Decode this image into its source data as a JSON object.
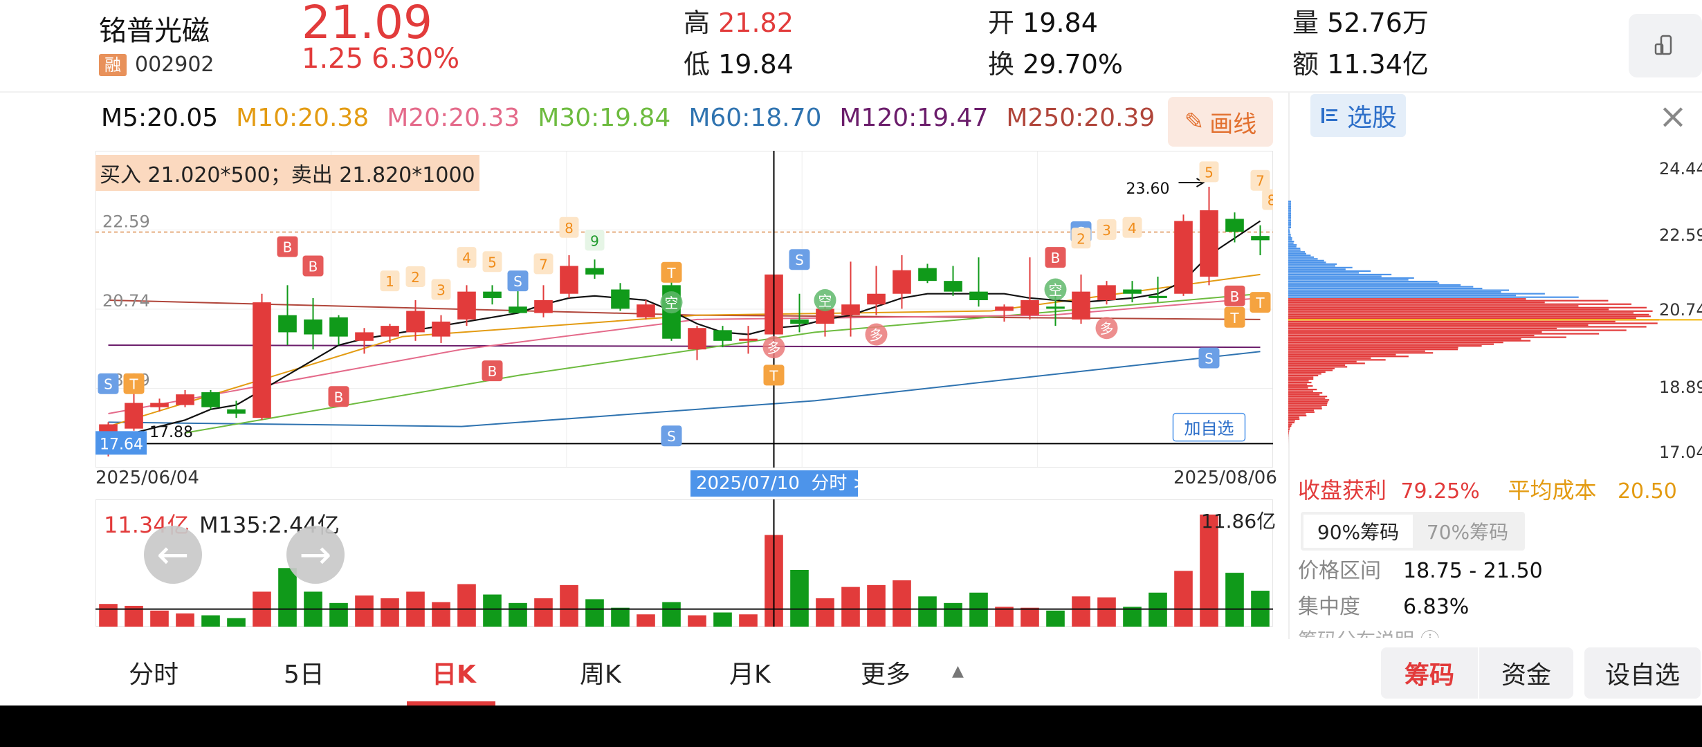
{
  "header": {
    "name": "铭普光磁",
    "badge": "融",
    "code": "002902",
    "price": "21.09",
    "change": "1.25",
    "change_pct": "6.30%",
    "stats": [
      {
        "label": "高",
        "value": "21.82",
        "color": "#e23b3b"
      },
      {
        "label": "低",
        "value": "19.84",
        "color": "#111111"
      },
      {
        "label": "开",
        "value": "19.84",
        "color": "#111111"
      },
      {
        "label": "换",
        "value": "29.70%",
        "color": "#111111"
      },
      {
        "label": "量",
        "value": "52.76万",
        "color": "#111111"
      },
      {
        "label": "额",
        "value": "11.34亿",
        "color": "#111111"
      }
    ]
  },
  "ma_bar": [
    {
      "text": "M5:20.05",
      "color": "#111111"
    },
    {
      "text": "M10:20.38",
      "color": "#e39b12"
    },
    {
      "text": "M20:20.33",
      "color": "#e46a8a"
    },
    {
      "text": "M30:19.84",
      "color": "#6dbb3f"
    },
    {
      "text": "M60:18.70",
      "color": "#2f73b0"
    },
    {
      "text": "M120:19.47",
      "color": "#6b1d6b"
    },
    {
      "text": "M250:20.39",
      "color": "#b0453a"
    }
  ],
  "draw_button": "画线",
  "trade_note": "买入 21.020*500；卖出 21.820*1000",
  "chart": {
    "y_labels": [
      "22.59",
      "20.74",
      "18.89"
    ],
    "high_marker": "23.60",
    "low_marker": "17.88",
    "low_badge": "17.64",
    "date_start": "2025/06/04",
    "date_end": "2025/08/06",
    "cursor_date": "2025/07/10",
    "cursor_link": "分时 >",
    "add_watch": "加自选"
  },
  "chart_data": {
    "type": "candlestick",
    "ylim": [
      17.04,
      24.44
    ],
    "candles": [
      {
        "o": 17.4,
        "h": 18.1,
        "l": 17.3,
        "c": 18.05
      },
      {
        "o": 17.95,
        "h": 18.8,
        "l": 17.9,
        "c": 18.55
      },
      {
        "o": 18.45,
        "h": 18.65,
        "l": 18.35,
        "c": 18.55
      },
      {
        "o": 18.5,
        "h": 18.85,
        "l": 18.45,
        "c": 18.75
      },
      {
        "o": 18.8,
        "h": 18.85,
        "l": 18.4,
        "c": 18.45
      },
      {
        "o": 18.4,
        "h": 18.6,
        "l": 18.2,
        "c": 18.3
      },
      {
        "o": 18.2,
        "h": 21.1,
        "l": 18.15,
        "c": 20.9
      },
      {
        "o": 20.6,
        "h": 21.3,
        "l": 19.9,
        "c": 20.2
      },
      {
        "o": 20.5,
        "h": 21.0,
        "l": 19.8,
        "c": 20.15
      },
      {
        "o": 20.55,
        "h": 20.6,
        "l": 19.9,
        "c": 20.1
      },
      {
        "o": 20.0,
        "h": 20.3,
        "l": 19.7,
        "c": 20.2
      },
      {
        "o": 20.1,
        "h": 20.4,
        "l": 19.95,
        "c": 20.35
      },
      {
        "o": 20.2,
        "h": 20.95,
        "l": 20.0,
        "c": 20.7
      },
      {
        "o": 20.1,
        "h": 20.6,
        "l": 19.95,
        "c": 20.45
      },
      {
        "o": 20.5,
        "h": 21.3,
        "l": 20.35,
        "c": 21.15
      },
      {
        "o": 21.15,
        "h": 21.3,
        "l": 20.85,
        "c": 21.0
      },
      {
        "o": 20.8,
        "h": 21.2,
        "l": 20.7,
        "c": 20.65
      },
      {
        "o": 20.65,
        "h": 21.3,
        "l": 20.55,
        "c": 20.95
      },
      {
        "o": 21.1,
        "h": 22.0,
        "l": 21.0,
        "c": 21.75
      },
      {
        "o": 21.7,
        "h": 21.9,
        "l": 21.45,
        "c": 21.55
      },
      {
        "o": 21.2,
        "h": 21.35,
        "l": 20.7,
        "c": 20.75
      },
      {
        "o": 20.55,
        "h": 20.95,
        "l": 20.5,
        "c": 20.85
      },
      {
        "o": 21.3,
        "h": 21.45,
        "l": 20.0,
        "c": 20.05
      },
      {
        "o": 19.8,
        "h": 20.35,
        "l": 19.55,
        "c": 20.3
      },
      {
        "o": 20.25,
        "h": 20.35,
        "l": 19.85,
        "c": 20.0
      },
      {
        "o": 20.0,
        "h": 20.35,
        "l": 19.7,
        "c": 20.05
      },
      {
        "o": 20.15,
        "h": 21.8,
        "l": 19.5,
        "c": 21.55
      },
      {
        "o": 20.5,
        "h": 21.1,
        "l": 20.2,
        "c": 20.4
      },
      {
        "o": 20.4,
        "h": 20.95,
        "l": 20.1,
        "c": 20.75
      },
      {
        "o": 20.6,
        "h": 21.85,
        "l": 20.1,
        "c": 20.85
      },
      {
        "o": 20.85,
        "h": 21.75,
        "l": 20.6,
        "c": 21.1
      },
      {
        "o": 21.1,
        "h": 22.0,
        "l": 20.75,
        "c": 21.65
      },
      {
        "o": 21.7,
        "h": 21.8,
        "l": 21.35,
        "c": 21.4
      },
      {
        "o": 21.4,
        "h": 21.75,
        "l": 21.05,
        "c": 21.15
      },
      {
        "o": 21.15,
        "h": 21.95,
        "l": 20.8,
        "c": 20.95
      },
      {
        "o": 20.7,
        "h": 20.85,
        "l": 20.45,
        "c": 20.8
      },
      {
        "o": 20.6,
        "h": 21.95,
        "l": 20.5,
        "c": 20.95
      },
      {
        "o": 20.8,
        "h": 21.05,
        "l": 20.35,
        "c": 20.75
      },
      {
        "o": 20.5,
        "h": 21.55,
        "l": 20.4,
        "c": 21.15
      },
      {
        "o": 20.95,
        "h": 21.4,
        "l": 20.85,
        "c": 21.3
      },
      {
        "o": 21.2,
        "h": 21.4,
        "l": 20.9,
        "c": 21.1
      },
      {
        "o": 21.05,
        "h": 21.5,
        "l": 20.9,
        "c": 21.0
      },
      {
        "o": 21.1,
        "h": 22.95,
        "l": 21.05,
        "c": 22.8
      },
      {
        "o": 21.5,
        "h": 23.6,
        "l": 21.3,
        "c": 23.05
      },
      {
        "o": 22.85,
        "h": 23.0,
        "l": 22.3,
        "c": 22.55
      },
      {
        "o": 22.45,
        "h": 22.7,
        "l": 22.0,
        "c": 22.35
      }
    ],
    "ma5": [
      17.8,
      17.85,
      18.0,
      18.15,
      18.4,
      18.5,
      18.85,
      19.2,
      19.55,
      19.9,
      20.05,
      20.15,
      20.25,
      20.35,
      20.45,
      20.55,
      20.65,
      20.85,
      21.0,
      21.05,
      21.0,
      20.95,
      20.7,
      20.4,
      20.2,
      20.15,
      20.3,
      20.35,
      20.5,
      20.6,
      20.8,
      21.0,
      21.1,
      21.1,
      21.1,
      21.1,
      21.0,
      20.95,
      20.9,
      20.95,
      21.0,
      21.1,
      21.4,
      22.0,
      22.4,
      22.8
    ],
    "volume": {
      "values": [
        2.4,
        2.2,
        1.7,
        1.4,
        1.2,
        0.9,
        3.7,
        6.2,
        3.7,
        2.5,
        3.3,
        3.0,
        3.7,
        2.6,
        4.5,
        3.4,
        2.5,
        3.0,
        4.4,
        2.9,
        2.0,
        1.3,
        2.6,
        1.2,
        1.5,
        1.3,
        9.7,
        6.0,
        3.0,
        4.2,
        4.4,
        4.9,
        3.2,
        2.5,
        3.6,
        2.1,
        2.0,
        1.7,
        3.2,
        3.1,
        2.1,
        3.6,
        5.9,
        11.86,
        5.7,
        3.8
      ],
      "ma": 2.44,
      "ylim": [
        0,
        12
      ]
    },
    "distribution_ylim": [
      17.04,
      24.44
    ]
  },
  "volume_panel": {
    "total": "11.34亿",
    "ma_label": "M135:2.44亿",
    "max_label": "11.86亿"
  },
  "right_panel": {
    "select_button": "选股",
    "y_labels": [
      "24.44",
      "22.59",
      "20.74",
      "18.89",
      "17.04"
    ],
    "profit_label": "收盘获利",
    "profit_value": "79.25%",
    "cost_label": "平均成本",
    "cost_value": "20.50",
    "tabs": [
      "90%筹码",
      "70%筹码"
    ],
    "range_label": "价格区间",
    "range_value": "18.75 - 21.50",
    "concentration_label": "集中度",
    "concentration_value": "6.83%",
    "help": "筹码分布说明"
  },
  "bottom_nav": {
    "tabs": [
      "分时",
      "5日",
      "日K",
      "周K",
      "月K",
      "更多"
    ],
    "active": "日K",
    "right_buttons": [
      "筹码",
      "资金",
      "设自选"
    ]
  },
  "colors": {
    "up": "#e23b3b",
    "down": "#109a1a",
    "accent": "#4d94ea"
  }
}
